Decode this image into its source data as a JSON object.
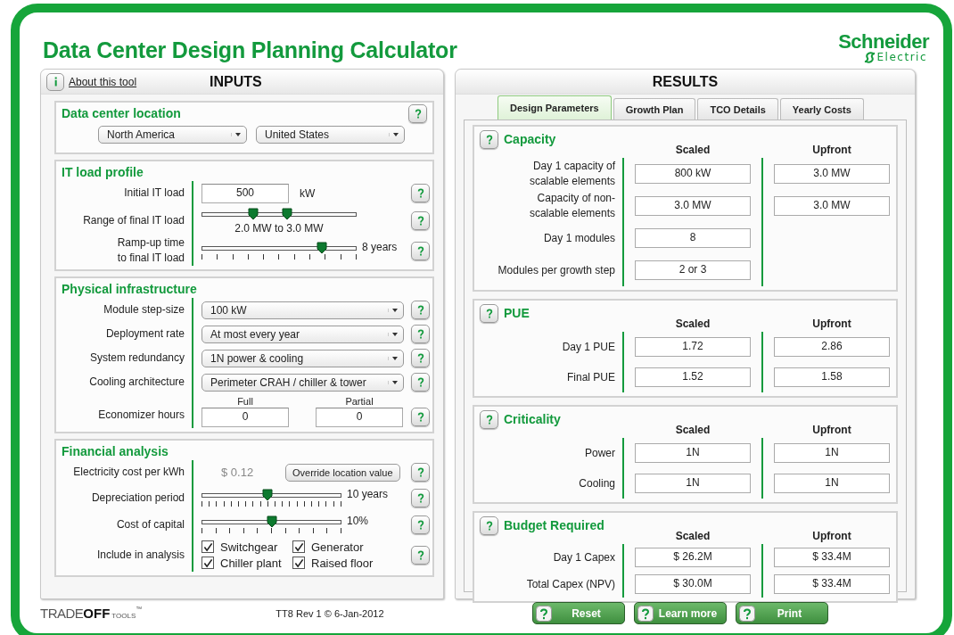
{
  "title": "Data Center Design Planning Calculator",
  "logo": {
    "name": "Schneider",
    "sub": "Electric"
  },
  "inputs": {
    "about_link": "About this tool",
    "title": "INPUTS",
    "sections": [
      {
        "title": "Data center location",
        "rows": [
          {
            "kind": "selects",
            "values": [
              "North America",
              "United States"
            ]
          }
        ]
      },
      {
        "title": "IT load profile",
        "rows": [
          {
            "kind": "input",
            "label": "Initial IT load",
            "value": "500",
            "unit": "kW"
          },
          {
            "kind": "range",
            "label": "Range of final IT load",
            "thumbs": [
              {
                "level": 0.33
              },
              {
                "level": 0.55
              }
            ],
            "reading": "2.0 MW to 3.0 MW"
          },
          {
            "kind": "slider",
            "label": "Ramp-up time\nto final IT load",
            "level": 0.78,
            "reading": "8 years"
          }
        ]
      },
      {
        "title": "Physical infrastructure",
        "rows": [
          {
            "kind": "select",
            "label": "Module step-size",
            "value": "100 kW"
          },
          {
            "kind": "select",
            "label": "Deployment rate",
            "value": "At most every year"
          },
          {
            "kind": "select",
            "label": "System redundancy",
            "value": "1N power & cooling"
          },
          {
            "kind": "select",
            "label": "Cooling architecture",
            "value": "Perimeter CRAH / chiller & tower"
          },
          {
            "kind": "pair",
            "label": "Economizer hours",
            "fields": [
              {
                "caption": "Full",
                "value": "0"
              },
              {
                "caption": "Partial",
                "value": "0"
              }
            ]
          }
        ]
      },
      {
        "title": "Financial analysis",
        "rows": [
          {
            "kind": "cost",
            "label": "Electricity cost per kWh",
            "value": "$ 0.12",
            "button": "Override location value"
          },
          {
            "kind": "slider",
            "label": "Depreciation period",
            "level": 0.47,
            "fine": true,
            "reading": "10 years"
          },
          {
            "kind": "slider",
            "label": "Cost of capital",
            "level": 0.5,
            "reading": "10%"
          },
          {
            "kind": "checks",
            "label": "Include in analysis",
            "items": [
              {
                "label": "Switchgear",
                "checked": true
              },
              {
                "label": "Generator",
                "checked": true
              },
              {
                "label": "Chiller plant",
                "checked": true
              },
              {
                "label": "Raised floor",
                "checked": true
              }
            ]
          }
        ]
      }
    ]
  },
  "results": {
    "title": "RESULTS",
    "tabs": [
      {
        "label": "Design Parameters",
        "selected": true
      },
      {
        "label": "Growth Plan",
        "selected": false
      },
      {
        "label": "TCO Details",
        "selected": false
      },
      {
        "label": "Yearly Costs",
        "selected": false
      }
    ],
    "groups": [
      {
        "title": "Capacity",
        "headers": [
          "Scaled",
          "Upfront"
        ],
        "rows": [
          {
            "label": "Day 1 capacity of\nscalable elements",
            "values": [
              "800 kW",
              "3.0 MW"
            ]
          },
          {
            "label": "Capacity of non-\nscalable elements",
            "values": [
              "3.0 MW",
              "3.0 MW"
            ]
          },
          {
            "label": "Day 1 modules",
            "values": [
              "8"
            ]
          },
          {
            "label": "Modules per growth step",
            "values": [
              "2 or 3"
            ]
          }
        ]
      },
      {
        "title": "PUE",
        "headers": [
          "Scaled",
          "Upfront"
        ],
        "rows": [
          {
            "label": "Day 1 PUE",
            "values": [
              "1.72",
              "2.86"
            ]
          },
          {
            "label": "Final PUE",
            "values": [
              "1.52",
              "1.58"
            ]
          }
        ]
      },
      {
        "title": "Criticality",
        "headers": [
          "Scaled",
          "Upfront"
        ],
        "rows": [
          {
            "label": "Power",
            "values": [
              "1N",
              "1N"
            ]
          },
          {
            "label": "Cooling",
            "values": [
              "1N",
              "1N"
            ]
          }
        ]
      },
      {
        "title": "Budget Required",
        "headers": [
          "Scaled",
          "Upfront"
        ],
        "rows": [
          {
            "label": "Day 1 Capex",
            "values": [
              "$ 26.2M",
              "$ 33.4M"
            ]
          },
          {
            "label": "Total Capex (NPV)",
            "values": [
              "$ 30.0M",
              "$ 33.4M"
            ]
          }
        ]
      }
    ]
  },
  "footer": {
    "brand": {
      "trade": "TRADE",
      "off": "OFF",
      "tools": "TOOLS",
      "mark": "™"
    },
    "version": "TT8 Rev 1  © 6-Jan-2012",
    "buttons": [
      "Reset",
      "Learn more",
      "Print"
    ]
  }
}
